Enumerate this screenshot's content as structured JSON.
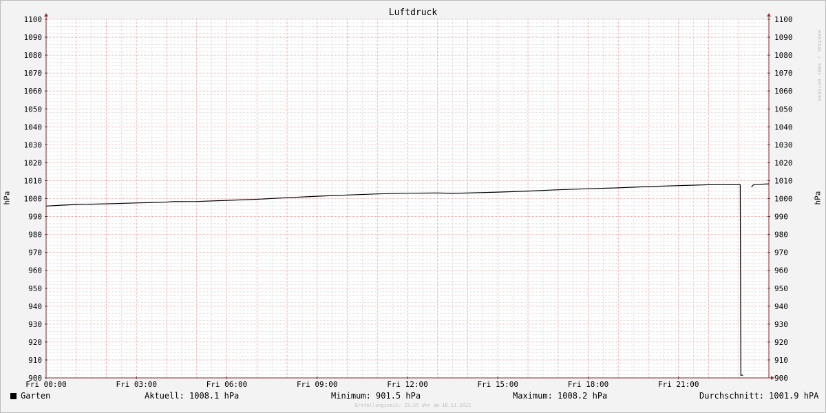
{
  "chart_data": {
    "type": "line",
    "title": "Luftdruck",
    "ylabel_left": "hPa",
    "ylabel_right": "hPa",
    "ylim": [
      900,
      1100
    ],
    "yticks": [
      900,
      910,
      920,
      930,
      940,
      950,
      960,
      970,
      980,
      990,
      1000,
      1010,
      1020,
      1030,
      1040,
      1050,
      1060,
      1070,
      1080,
      1090,
      1100
    ],
    "xlim_hours": [
      0,
      24
    ],
    "xticks": [
      {
        "hour": 0,
        "label": "Fri 00:00"
      },
      {
        "hour": 3,
        "label": "Fri 03:00"
      },
      {
        "hour": 6,
        "label": "Fri 06:00"
      },
      {
        "hour": 9,
        "label": "Fri 09:00"
      },
      {
        "hour": 12,
        "label": "Fri 12:00"
      },
      {
        "hour": 15,
        "label": "Fri 15:00"
      },
      {
        "hour": 18,
        "label": "Fri 18:00"
      },
      {
        "hour": 21,
        "label": "Fri 21:00"
      }
    ],
    "series": [
      {
        "name": "Garten",
        "color": "#000000",
        "points": [
          [
            0.0,
            995.8
          ],
          [
            0.5,
            996.3
          ],
          [
            1.0,
            996.7
          ],
          [
            2.0,
            997.1
          ],
          [
            3.0,
            997.6
          ],
          [
            4.0,
            998.0
          ],
          [
            4.2,
            998.3
          ],
          [
            5.0,
            998.4
          ],
          [
            6.0,
            999.0
          ],
          [
            7.0,
            999.6
          ],
          [
            8.0,
            1000.5
          ],
          [
            9.0,
            1001.3
          ],
          [
            10.0,
            1002.0
          ],
          [
            11.0,
            1002.6
          ],
          [
            12.0,
            1003.0
          ],
          [
            13.0,
            1003.1
          ],
          [
            13.5,
            1002.9
          ],
          [
            14.0,
            1003.1
          ],
          [
            15.0,
            1003.6
          ],
          [
            16.0,
            1004.2
          ],
          [
            17.0,
            1004.9
          ],
          [
            18.0,
            1005.5
          ],
          [
            19.0,
            1006.0
          ],
          [
            20.0,
            1006.7
          ],
          [
            21.0,
            1007.2
          ],
          [
            22.0,
            1007.7
          ],
          [
            22.8,
            1007.8
          ],
          [
            23.05,
            1007.7
          ],
          [
            23.07,
            901.5
          ],
          [
            23.14,
            901.5
          ],
          [
            23.15,
            null
          ],
          [
            23.42,
            1006.5
          ],
          [
            23.5,
            1007.8
          ],
          [
            24.0,
            1008.2
          ]
        ]
      }
    ],
    "legend": {
      "series_name": "Garten",
      "current": "Aktuell: 1008.1 hPa",
      "minimum": "Minimum: 901.5 hPa",
      "maximum": "Maximum: 1008.2 hPa",
      "average": "Durchschnitt: 1001.9 hPA"
    },
    "grid": true
  },
  "watermark": "RRDTOOL / TOBI OETIKER",
  "footer": "Erstellungszeit: 23:55 Uhr am 18.11.2022",
  "colors": {
    "major_grid": "#e89a9a",
    "minor_grid": "#c8c8c8",
    "line": "#000000",
    "axis": "#7a2a2a"
  }
}
